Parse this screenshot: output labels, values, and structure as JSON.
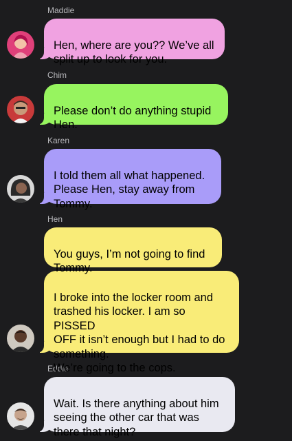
{
  "colors": {
    "background": "#1c1c1e",
    "maddie_bubble": "#f0a2e1",
    "chim_bubble": "#97f45f",
    "karen_bubble": "#a99cf9",
    "hen_bubble": "#f9ec78",
    "eddie_bubble": "#e9e9f1",
    "sender_label": "#b9b9bd"
  },
  "messages": [
    {
      "sender": "Maddie",
      "avatar": "maddie-avatar",
      "bubbles": [
        "Hen, where are you?? We’ve all\nsplit up to look for you."
      ]
    },
    {
      "sender": "Chim",
      "avatar": "chim-avatar",
      "bubbles": [
        "Please don’t do anything stupid\nHen."
      ]
    },
    {
      "sender": "Karen",
      "avatar": "karen-avatar",
      "bubbles": [
        "I told them all what happened.\nPlease Hen, stay away from\nTommy."
      ]
    },
    {
      "sender": "Hen",
      "avatar": "hen-avatar",
      "bubbles": [
        "You guys, I’m not going to find\nTommy.",
        "I broke into the locker room and\ntrashed his locker. I am so PISSED\nOFF it isn’t enough but I had to do\nsomething.\nWe’re going to the cops."
      ]
    },
    {
      "sender": "Eddie",
      "avatar": "eddie-avatar",
      "bubbles": [
        "Wait. Is there anything about him\nseeing the other car that was\nthere that night?"
      ]
    }
  ]
}
